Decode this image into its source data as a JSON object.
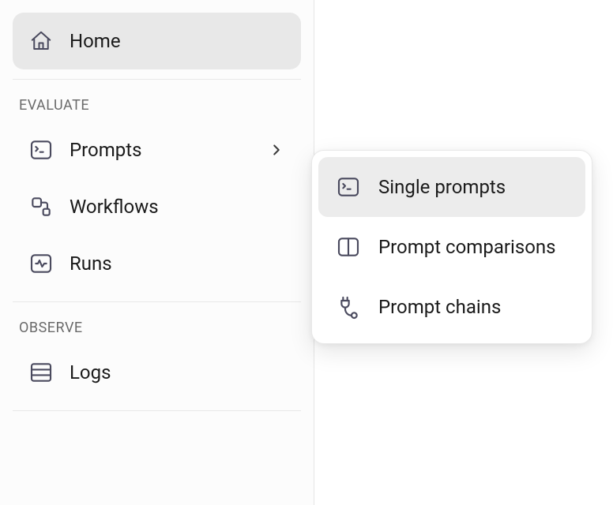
{
  "sidebar": {
    "home_label": "Home",
    "sections": {
      "evaluate": {
        "title": "EVALUATE",
        "items": {
          "prompts": {
            "label": "Prompts"
          },
          "workflows": {
            "label": "Workflows"
          },
          "runs": {
            "label": "Runs"
          }
        }
      },
      "observe": {
        "title": "OBSERVE",
        "items": {
          "logs": {
            "label": "Logs"
          }
        }
      }
    }
  },
  "flyout": {
    "items": {
      "single_prompts": {
        "label": "Single prompts"
      },
      "prompt_comparisons": {
        "label": "Prompt comparisons"
      },
      "prompt_chains": {
        "label": "Prompt chains"
      }
    }
  },
  "colors": {
    "icon": "#4a4a5e",
    "text": "#1a1a1a"
  }
}
